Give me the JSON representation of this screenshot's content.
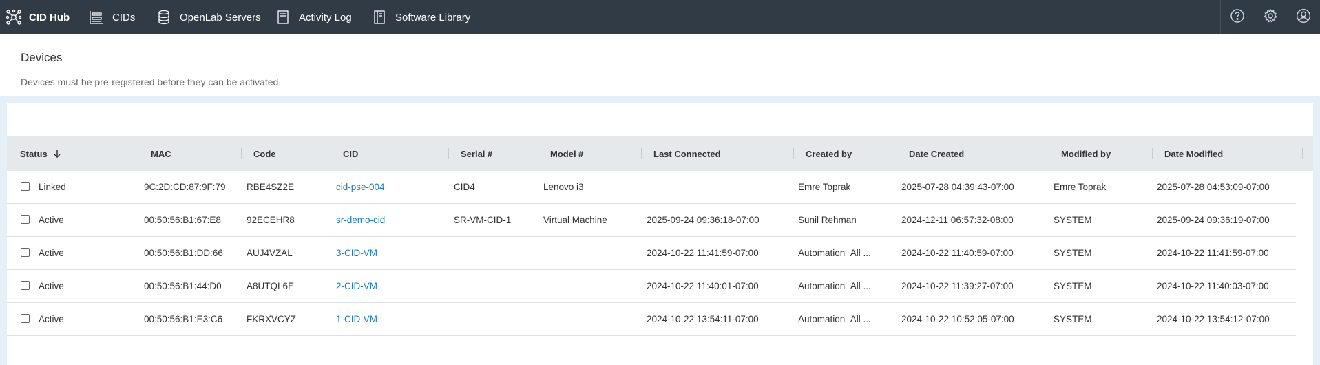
{
  "nav": {
    "brand": "CID Hub",
    "items": [
      {
        "label": "CIDs",
        "icon": "cids-list-icon"
      },
      {
        "label": "OpenLab Servers",
        "icon": "database-icon"
      },
      {
        "label": "Activity Log",
        "icon": "log-document-icon"
      },
      {
        "label": "Software Library",
        "icon": "library-book-icon"
      }
    ],
    "right_icons": [
      "help-icon",
      "settings-gear-icon",
      "user-profile-icon"
    ]
  },
  "page": {
    "title": "Devices",
    "subtitle": "Devices must be pre-registered before they can be activated."
  },
  "table": {
    "columns": [
      "Status",
      "MAC",
      "Code",
      "CID",
      "Serial #",
      "Model #",
      "Last Connected",
      "Created by",
      "Date Created",
      "Modified by",
      "Date Modified"
    ],
    "sort": {
      "column": "Status",
      "direction": "descending"
    },
    "rows": [
      {
        "status": "Linked",
        "mac": "9C:2D:CD:87:9F:79",
        "code": "RBE4SZ2E",
        "cid": "cid-pse-004",
        "serial": "CID4",
        "model": "Lenovo i3",
        "last_connected": "",
        "created_by": "Emre Toprak",
        "date_created": "2025-07-28 04:39:43-07:00",
        "modified_by": "Emre Toprak",
        "date_modified": "2025-07-28 04:53:09-07:00"
      },
      {
        "status": "Active",
        "mac": "00:50:56:B1:67:E8",
        "code": "92ECEHR8",
        "cid": "sr-demo-cid",
        "serial": "SR-VM-CID-1",
        "model": "Virtual Machine",
        "last_connected": "2025-09-24 09:36:18-07:00",
        "created_by": "Sunil Rehman",
        "date_created": "2024-12-11 06:57:32-08:00",
        "modified_by": "SYSTEM",
        "date_modified": "2025-09-24 09:36:19-07:00"
      },
      {
        "status": "Active",
        "mac": "00:50:56:B1:DD:66",
        "code": "AUJ4VZAL",
        "cid": "3-CID-VM",
        "serial": "",
        "model": "",
        "last_connected": "2024-10-22 11:41:59-07:00",
        "created_by": "Automation_All ...",
        "date_created": "2024-10-22 11:40:59-07:00",
        "modified_by": "SYSTEM",
        "date_modified": "2024-10-22 11:41:59-07:00"
      },
      {
        "status": "Active",
        "mac": "00:50:56:B1:44:D0",
        "code": "A8UTQL6E",
        "cid": "2-CID-VM",
        "serial": "",
        "model": "",
        "last_connected": "2024-10-22 11:40:01-07:00",
        "created_by": "Automation_All ...",
        "date_created": "2024-10-22 11:39:27-07:00",
        "modified_by": "SYSTEM",
        "date_modified": "2024-10-22 11:40:03-07:00"
      },
      {
        "status": "Active",
        "mac": "00:50:56:B1:E3:C6",
        "code": "FKRXVCYZ",
        "cid": "1-CID-VM",
        "serial": "",
        "model": "",
        "last_connected": "2024-10-22 13:54:11-07:00",
        "created_by": "Automation_All ...",
        "date_created": "2024-10-22 10:52:05-07:00",
        "modified_by": "SYSTEM",
        "date_modified": "2024-10-22 13:54:12-07:00"
      }
    ]
  },
  "colors": {
    "topbar": "#313b46",
    "link": "#1f7ab8",
    "page_bg": "#e4eff7",
    "header_row": "#e6e9ec"
  }
}
